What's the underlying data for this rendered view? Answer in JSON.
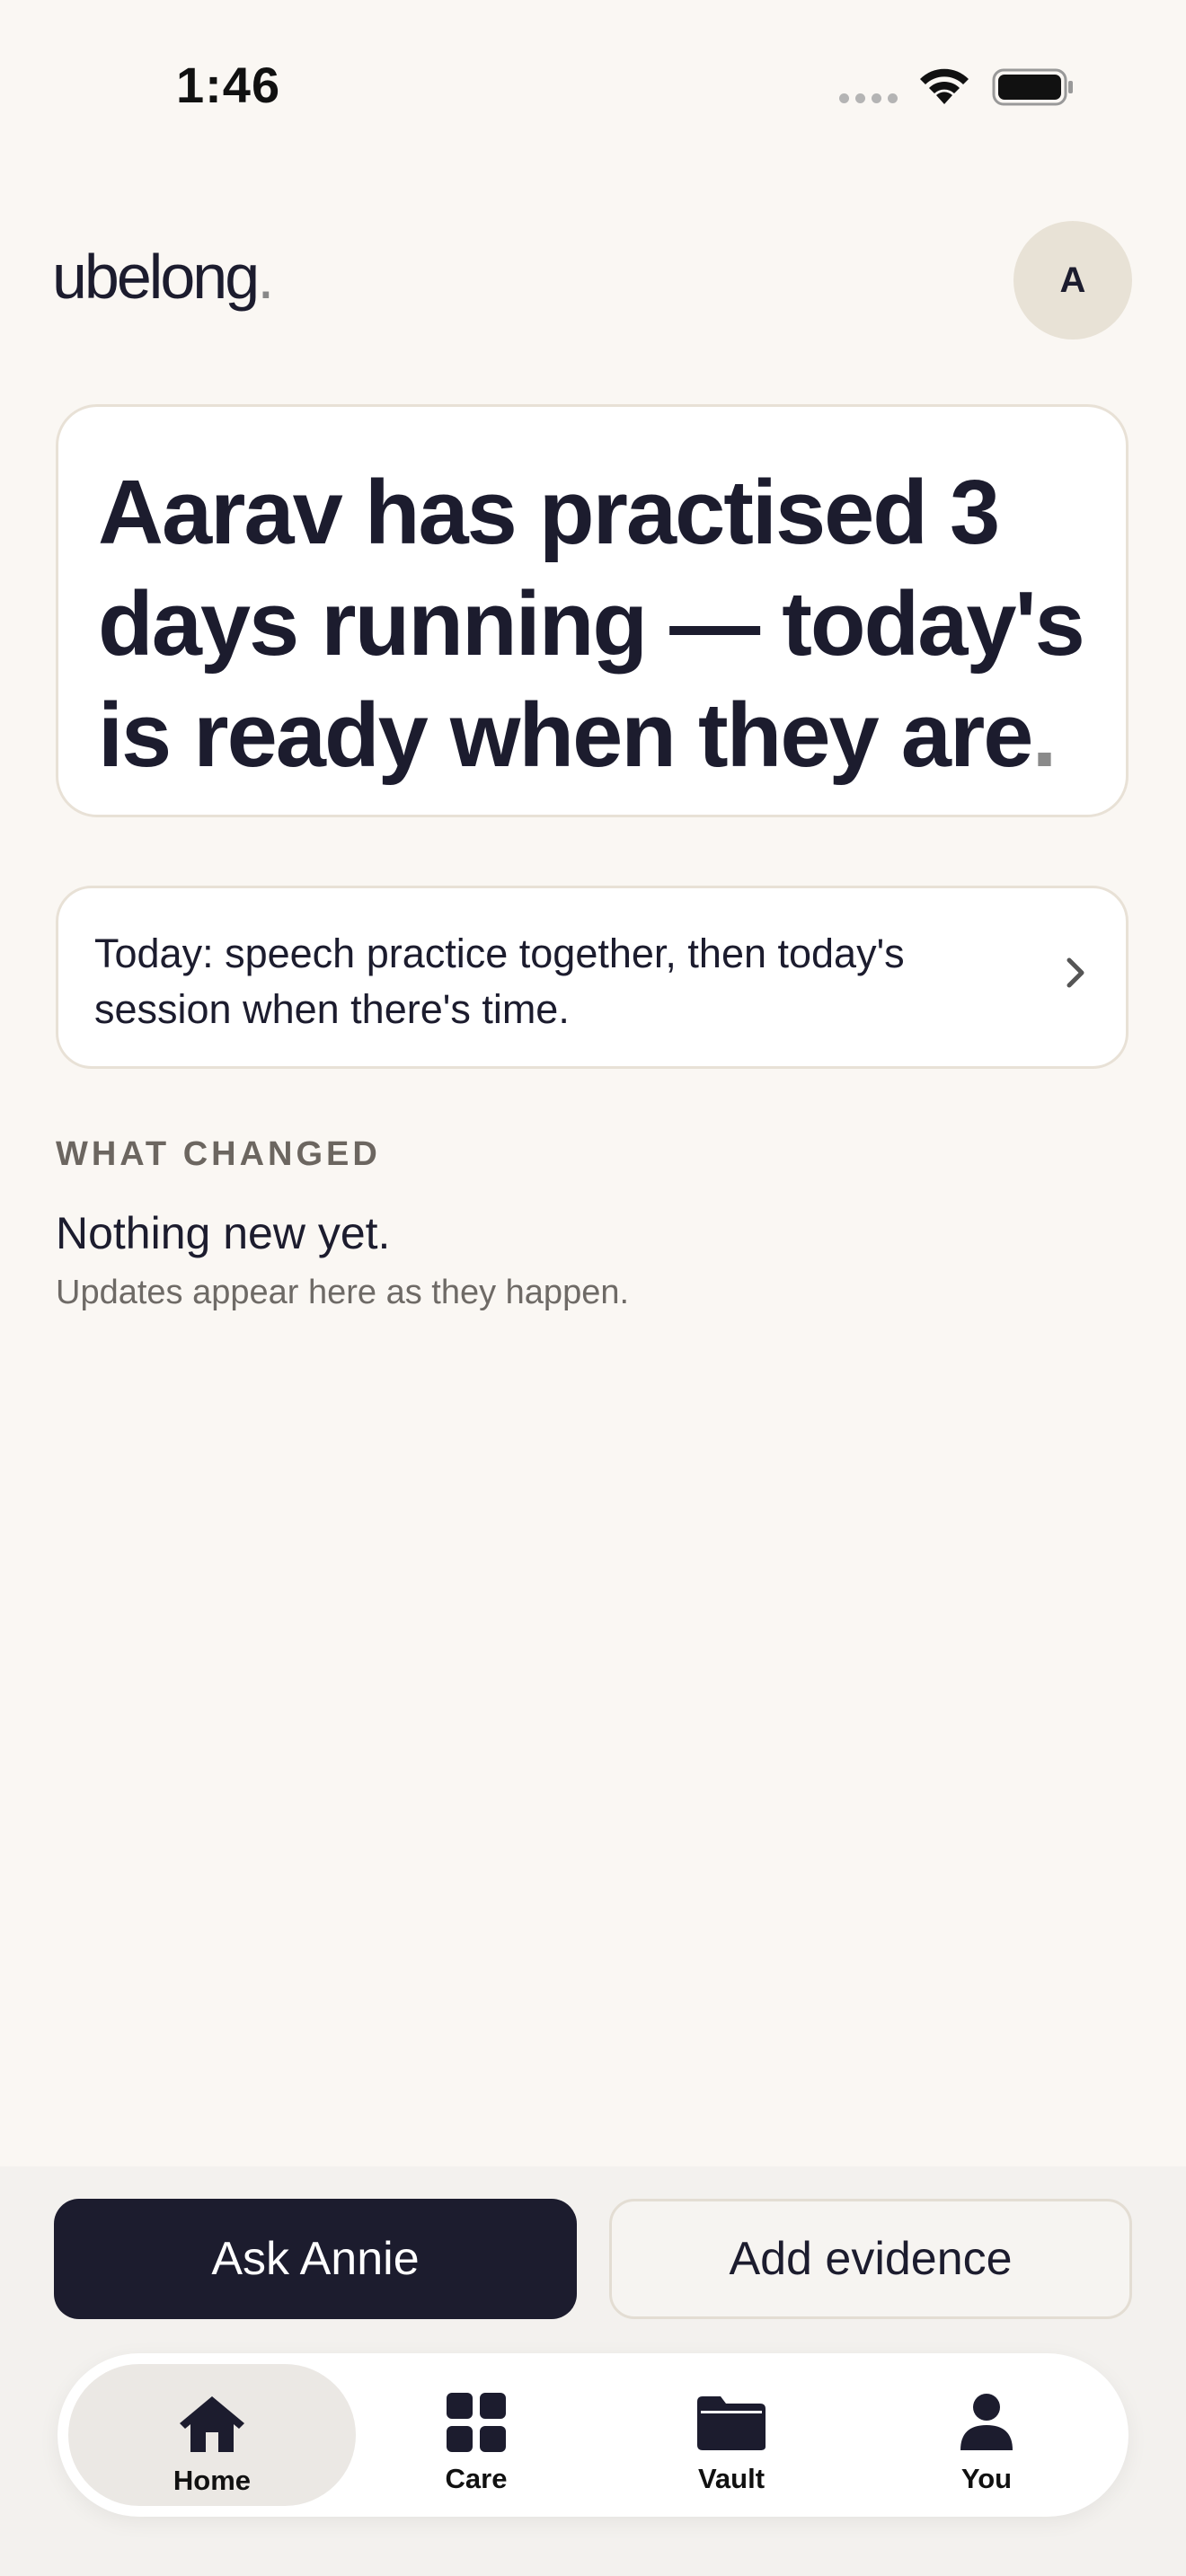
{
  "status_bar": {
    "time": "1:46"
  },
  "header": {
    "logo_text": "ubelong",
    "logo_dot": ".",
    "avatar_initial": "A"
  },
  "hero": {
    "text": "Aarav has practised 3 days running — today's is ready when they are",
    "trailing_dot": "."
  },
  "today_card": {
    "text": "Today: speech practice together, then today's session when there's time."
  },
  "what_changed": {
    "label": "WHAT CHANGED",
    "empty_title": "Nothing new yet.",
    "empty_subtitle": "Updates appear here as they happen."
  },
  "actions": {
    "primary": "Ask Annie",
    "secondary": "Add evidence"
  },
  "tab_bar": {
    "active": "Home",
    "tabs": [
      {
        "label": "Home",
        "icon": "home-icon"
      },
      {
        "label": "Care",
        "icon": "grid-icon"
      },
      {
        "label": "Vault",
        "icon": "folder-icon"
      },
      {
        "label": "You",
        "icon": "person-icon"
      }
    ]
  },
  "colors": {
    "background": "#faf7f3",
    "ink": "#1c1c2e",
    "card_border": "#e8e1d6",
    "avatar_bg": "#e8e2d6",
    "active_tab_bg": "#ebe8e4"
  }
}
